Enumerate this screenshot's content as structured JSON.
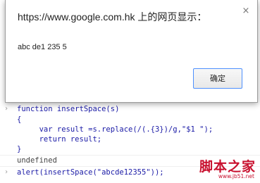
{
  "dialog": {
    "title": "https://www.google.com.hk 上的网页显示：",
    "message": "abc de1 235 5",
    "ok_label": "确定",
    "close_glyph": "×"
  },
  "console": {
    "prompt_glyph": "›",
    "lines": [
      {
        "type": "input",
        "text": "function insertSpace(s)"
      },
      {
        "type": "cont",
        "text": "{"
      },
      {
        "type": "cont",
        "text": "     var result =s.replace(/(.{3})/g,\"$1 \");"
      },
      {
        "type": "cont",
        "text": "     return result;"
      },
      {
        "type": "cont",
        "text": "}"
      },
      {
        "type": "output",
        "text": "undefined"
      },
      {
        "type": "input",
        "text": "alert(insertSpace(\"abcde12355\"));"
      }
    ]
  },
  "watermark": {
    "title": "脚本之家",
    "url": "www.jb51.net"
  },
  "colors": {
    "code": "#1a1aa6",
    "output": "#444444",
    "watermark": "#c8102e",
    "button_focus": "#4d90fe"
  }
}
